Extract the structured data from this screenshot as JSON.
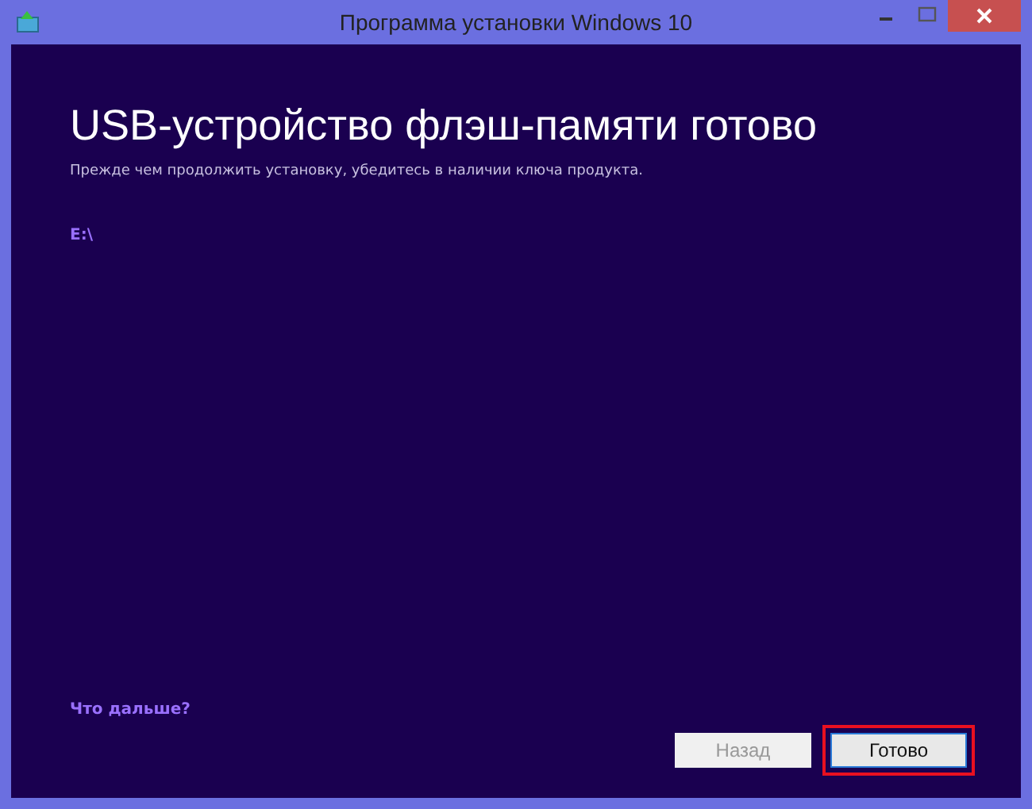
{
  "window": {
    "title": "Программа установки Windows 10"
  },
  "heading": "USB-устройство флэш-памяти готово",
  "subtitle": "Прежде чем продолжить установку, убедитесь в наличии ключа продукта.",
  "drive": "E:\\",
  "link": "Что дальше?",
  "buttons": [
    {
      "label": "Назад",
      "disabled": true,
      "highlighted": false
    },
    {
      "label": "Готово",
      "disabled": false,
      "highlighted": true
    }
  ]
}
